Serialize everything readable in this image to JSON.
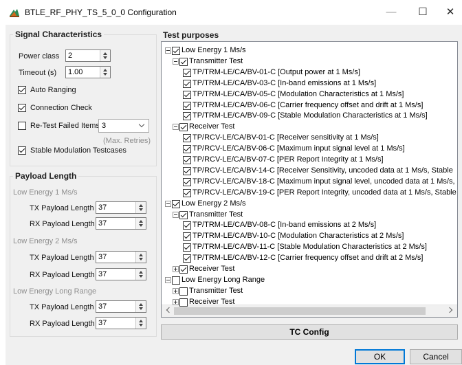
{
  "window": {
    "title": "BTLE_RF_PHY_TS_5_0_0 Configuration",
    "minimize": "—",
    "maximize": "☐",
    "close": "✕",
    "icon": "app-icon"
  },
  "signal": {
    "title": "Signal Characteristics",
    "power_class_label": "Power class",
    "power_class_value": "2",
    "timeout_label": "Timeout (s)",
    "timeout_value": "1.00",
    "auto_ranging": "Auto Ranging",
    "auto_ranging_checked": true,
    "connection_check": "Connection Check",
    "connection_check_checked": true,
    "retest_failed": "Re-Test Failed Items",
    "retest_failed_checked": false,
    "retest_count": "3",
    "max_retries": "(Max. Retries)",
    "stable_mod": "Stable Modulation Testcases",
    "stable_mod_checked": true
  },
  "payload": {
    "title": "Payload Length",
    "groups": [
      {
        "name": "Low Energy 1 Ms/s",
        "tx_label": "TX Payload Length",
        "tx_value": "37",
        "rx_label": "RX Payload Length",
        "rx_value": "37"
      },
      {
        "name": "Low Energy 2 Ms/s",
        "tx_label": "TX Payload Length",
        "tx_value": "37",
        "rx_label": "RX Payload Length",
        "rx_value": "37"
      },
      {
        "name": "Low Energy Long Range",
        "tx_label": "TX Payload Length",
        "tx_value": "37",
        "rx_label": "RX Payload Length",
        "rx_value": "37"
      }
    ]
  },
  "tests": {
    "title": "Test purposes",
    "nodes": [
      {
        "text": "Low Energy 1 Ms/s",
        "checked": true,
        "expander": "minus"
      },
      {
        "text": "Transmitter Test",
        "checked": true,
        "expander": "minus"
      },
      {
        "text": "TP/TRM-LE/CA/BV-01-C [Output power at 1 Ms/s]",
        "checked": true
      },
      {
        "text": "TP/TRM-LE/CA/BV-03-C [In-band emissions at 1 Ms/s]",
        "checked": true
      },
      {
        "text": "TP/TRM-LE/CA/BV-05-C [Modulation Characteristics at 1 Ms/s]",
        "checked": true
      },
      {
        "text": "TP/TRM-LE/CA/BV-06-C [Carrier frequency offset and drift at 1 Ms/s]",
        "checked": true
      },
      {
        "text": "TP/TRM-LE/CA/BV-09-C [Stable Modulation Characteristics at 1 Ms/s]",
        "checked": true
      },
      {
        "text": "Receiver Test",
        "checked": true,
        "expander": "minus"
      },
      {
        "text": "TP/RCV-LE/CA/BV-01-C [Receiver sensitivity at 1 Ms/s]",
        "checked": true
      },
      {
        "text": "TP/RCV-LE/CA/BV-06-C [Maximum input signal level at 1 Ms/s]",
        "checked": true
      },
      {
        "text": "TP/RCV-LE/CA/BV-07-C [PER Report Integrity at 1 Ms/s]",
        "checked": true
      },
      {
        "text": "TP/RCV-LE/CA/BV-14-C [Receiver Sensitivity, uncoded data at 1 Ms/s, Stable",
        "checked": true
      },
      {
        "text": "TP/RCV-LE/CA/BV-18-C [Maximum input signal level, uncoded data at 1 Ms/s,",
        "checked": true
      },
      {
        "text": "TP/RCV-LE/CA/BV-19-C [PER Report Integrity, uncoded data at 1 Ms/s, Stable",
        "checked": true
      },
      {
        "text": "Low Energy 2 Ms/s",
        "checked": true,
        "expander": "minus"
      },
      {
        "text": "Transmitter Test",
        "checked": true,
        "expander": "minus"
      },
      {
        "text": "TP/TRM-LE/CA/BV-08-C [In-band emissions at 2 Ms/s]",
        "checked": true
      },
      {
        "text": "TP/TRM-LE/CA/BV-10-C [Modulation Characteristics at 2 Ms/s]",
        "checked": true
      },
      {
        "text": "TP/TRM-LE/CA/BV-11-C [Stable Modulation Characteristics at 2 Ms/s]",
        "checked": true
      },
      {
        "text": "TP/TRM-LE/CA/BV-12-C [Carrier frequency offset and drift at 2 Ms/s]",
        "checked": true
      },
      {
        "text": "Receiver Test",
        "checked": true,
        "expander": "plus"
      },
      {
        "text": "Low Energy Long Range",
        "checked": false,
        "expander": "minus"
      },
      {
        "text": "Transmitter Test",
        "checked": false,
        "expander": "plus"
      },
      {
        "text": "Receiver Test",
        "checked": false,
        "expander": "plus"
      }
    ]
  },
  "tc_config": "TC Config",
  "buttons": {
    "ok": "OK",
    "cancel": "Cancel"
  }
}
